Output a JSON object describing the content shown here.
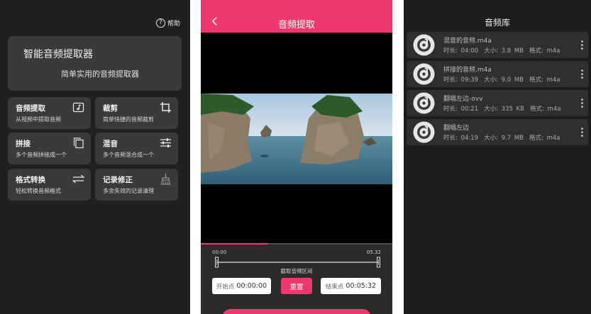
{
  "home": {
    "help_label": "帮助",
    "hero_title": "智能音频提取器",
    "hero_subtitle": "简单实用的音频提取器",
    "cards": [
      {
        "title": "音频提取",
        "subtitle": "从视频中提取音频",
        "icon": "music-note-icon"
      },
      {
        "title": "裁剪",
        "subtitle": "简单快捷的音频裁剪",
        "icon": "crop-icon"
      },
      {
        "title": "拼接",
        "subtitle": "多个音频拼接成一个",
        "icon": "copy-icon"
      },
      {
        "title": "混音",
        "subtitle": "多个音频混合成一个",
        "icon": "sliders-icon"
      },
      {
        "title": "格式转换",
        "subtitle": "轻松转换音频格式",
        "icon": "swap-arrows-icon"
      },
      {
        "title": "记录修正",
        "subtitle": "多余失效的记录清理",
        "icon": "broom-icon"
      }
    ]
  },
  "extract": {
    "title": "音频提取",
    "progress_fraction": 0.35,
    "timeline_start": "00:00",
    "timeline_end": "05:32",
    "range_label": "截取音频区间",
    "start_label": "开始点",
    "start_value": "00:00:00",
    "reset_label": "重置",
    "end_label": "结束点",
    "end_value": "00:05:32",
    "accent_color": "#ee3870"
  },
  "library": {
    "title": "音频库",
    "items": [
      {
        "name": "混音的音频.m4a",
        "duration": "时长: 04:00",
        "size": "大小: 3.8 MB",
        "format": "格式: m4a"
      },
      {
        "name": "拼接的音频.m4a",
        "duration": "时长: 09:39",
        "size": "大小: 9.0 MB",
        "format": "格式: m4a"
      },
      {
        "name": "翻唱左边-ovv",
        "duration": "时长: 00:21",
        "size": "大小: 335 KB",
        "format": "格式: m4a"
      },
      {
        "name": "翻唱左边",
        "duration": "时长: 04:19",
        "size": "大小: 9.7 MB",
        "format": "格式: m4a"
      }
    ]
  }
}
